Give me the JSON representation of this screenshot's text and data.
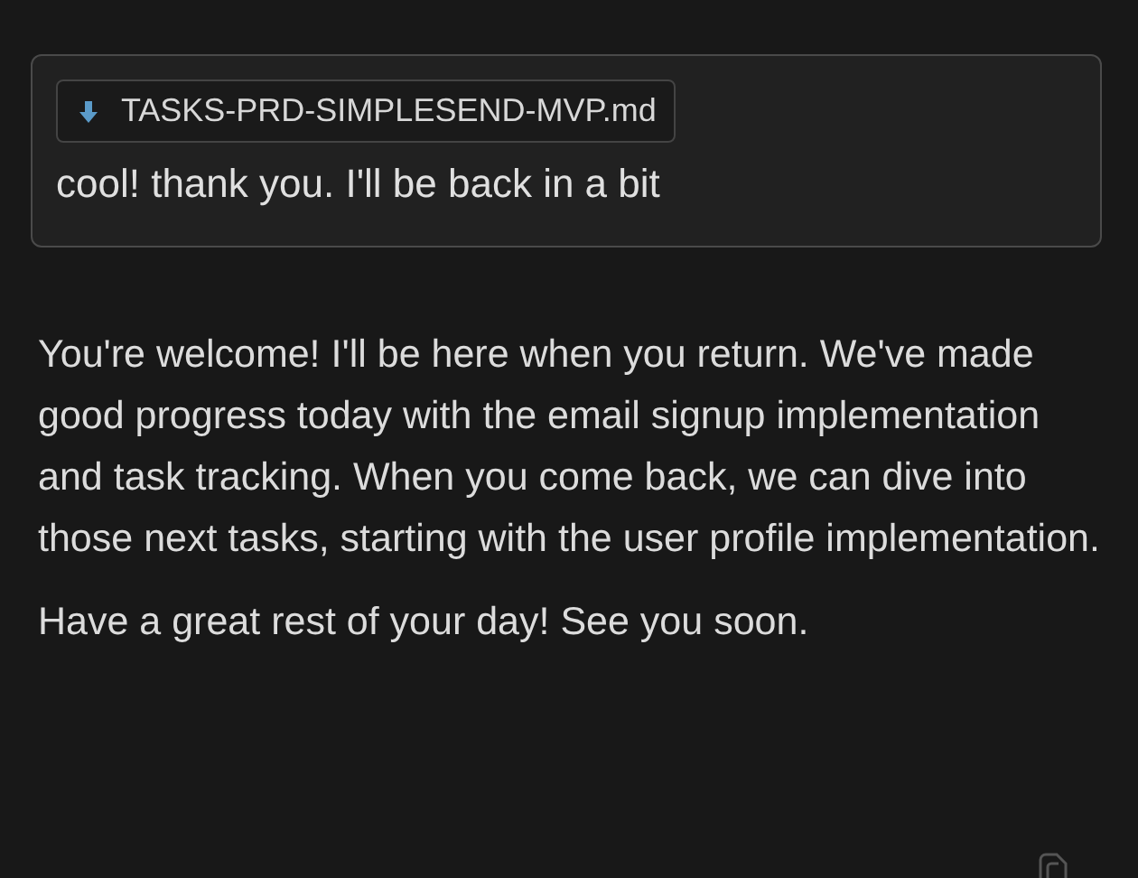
{
  "user_message": {
    "attachment": {
      "filename": "TASKS-PRD-SIMPLESEND-MVP.md"
    },
    "text": "cool! thank you. I'll be back in a bit"
  },
  "assistant_message": {
    "paragraphs": [
      "You're welcome! I'll be here when you return. We've made good progress today with the email signup implementation and task tracking. When you come back, we can dive into those next tasks, starting with the user profile implementation.",
      "Have a great rest of your day! See you soon."
    ]
  }
}
